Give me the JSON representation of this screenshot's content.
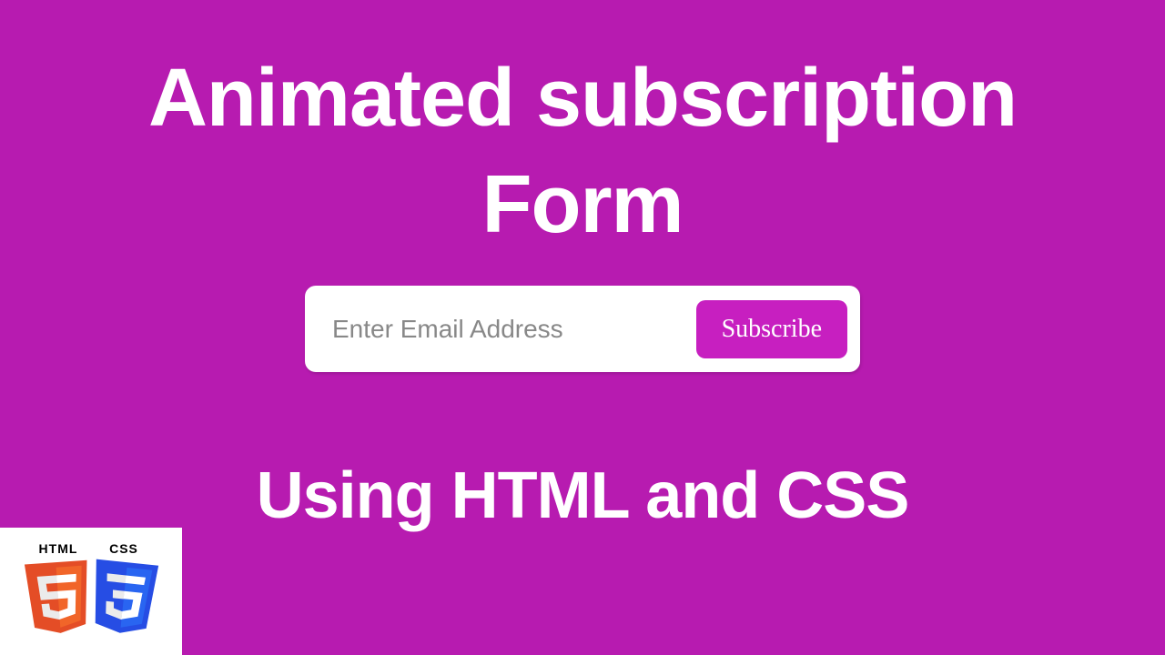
{
  "title_line1": "Animated subscription",
  "title_line2": "Form",
  "form": {
    "email_placeholder": "Enter Email Address",
    "email_value": "",
    "subscribe_label": "Subscribe"
  },
  "subtitle": "Using HTML and CSS",
  "badges": {
    "html_label": "HTML",
    "css_label": "CSS",
    "html_number": "5",
    "css_number": "3"
  },
  "colors": {
    "background": "#b71bb0",
    "button": "#c71fc0",
    "html_shield": "#e44d26",
    "css_shield": "#2965f1"
  }
}
